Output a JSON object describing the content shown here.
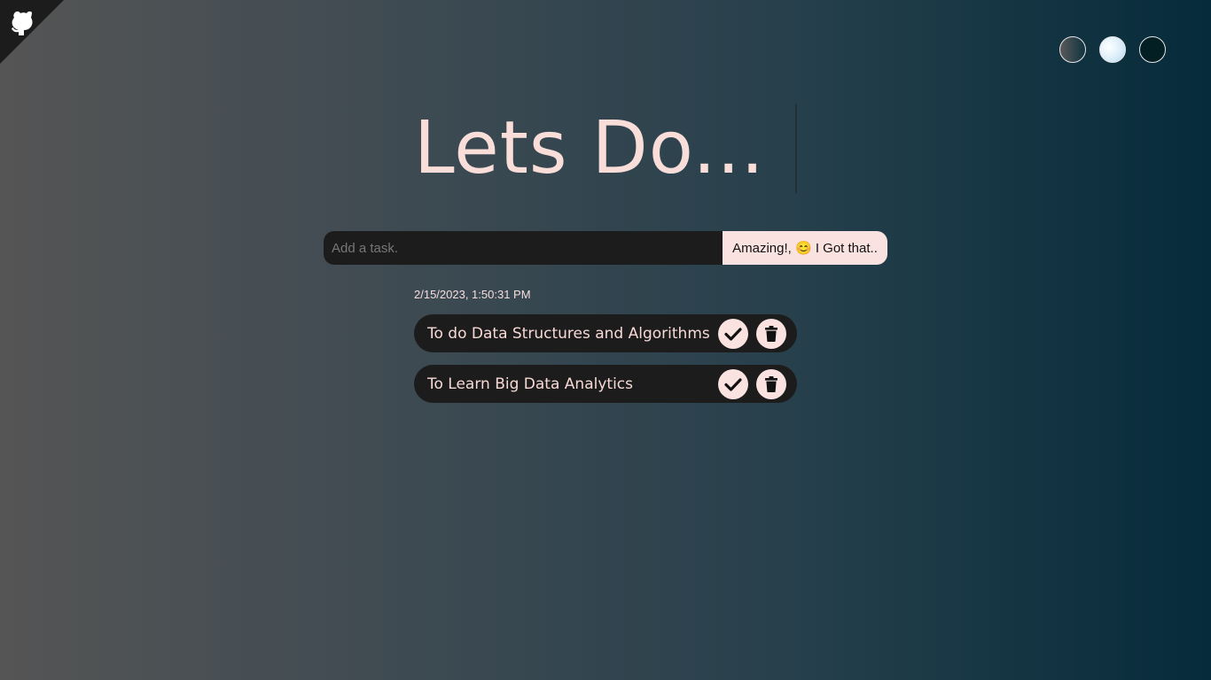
{
  "corner": {
    "icon": "github-octocat-icon"
  },
  "themes": [
    {
      "name": "standard",
      "icon": "theme-standard-swatch"
    },
    {
      "name": "light",
      "icon": "theme-light-swatch"
    },
    {
      "name": "darker",
      "icon": "theme-darker-swatch"
    }
  ],
  "header": {
    "title": "Lets Do..."
  },
  "form": {
    "placeholder": "Add a task.",
    "value": "",
    "button_label": "Amazing!, 😊 I Got that.."
  },
  "datetime": "2/15/2023, 1:50:31 PM",
  "todos": [
    {
      "text": "To do Data Structures and Algorithms",
      "check_icon": "check-icon",
      "delete_icon": "trash-icon"
    },
    {
      "text": "To Learn Big Data Analytics",
      "check_icon": "check-icon",
      "delete_icon": "trash-icon"
    }
  ],
  "colors": {
    "accent": "#f9e2df",
    "title": "#f9ddd9",
    "item_bg": "#1c1c1c",
    "bg_start": "#555555",
    "bg_end": "#062b3b"
  }
}
